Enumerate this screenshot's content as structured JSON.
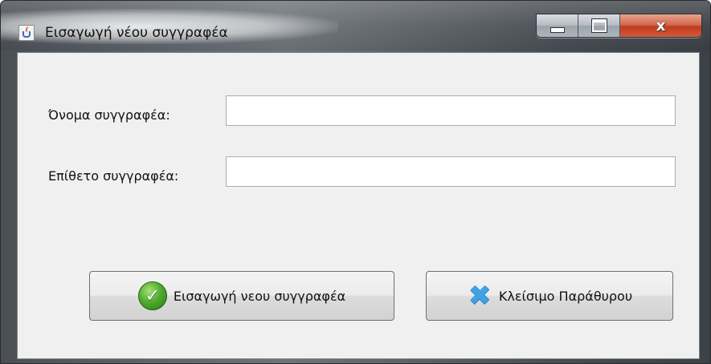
{
  "window": {
    "title": "Εισαγωγή νέου συγγραφέα"
  },
  "controls": {
    "minimize_icon": "minimize-icon",
    "maximize_icon": "maximize-icon",
    "close_icon": "close-icon",
    "close_glyph": "x"
  },
  "form": {
    "first_name_label": "Όνομα συγγραφέα:",
    "first_name_value": "",
    "last_name_label": "Επίθετο συγγραφέα:",
    "last_name_value": ""
  },
  "buttons": {
    "insert_label": "Εισαγωγή νεου συγγραφέα",
    "insert_icon": "checkmark-icon",
    "close_label": "Κλείσιμο Παράθυρου",
    "close_icon": "blue-x-icon"
  },
  "colors": {
    "check_green": "#4fae2e",
    "x_blue": "#3fa3e6",
    "close_red": "#c13b1f"
  }
}
